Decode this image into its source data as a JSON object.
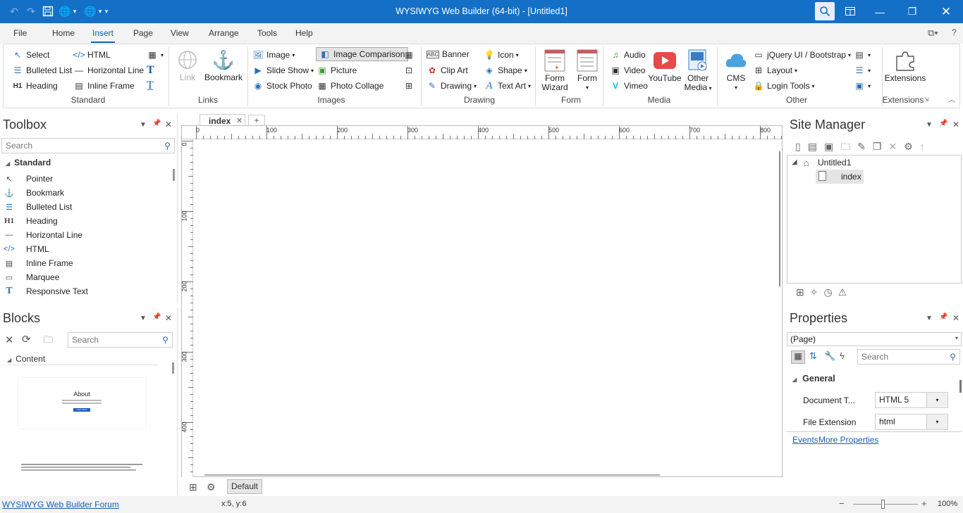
{
  "titlebar": {
    "title": "WYSIWYG Web Builder (64-bit) - [Untitled1]"
  },
  "menu": {
    "items": [
      "File",
      "Home",
      "Insert",
      "Page",
      "View",
      "Arrange",
      "Tools",
      "Help"
    ],
    "active": "Insert"
  },
  "ribbon": {
    "standard": {
      "select": "Select",
      "html": "HTML",
      "bulleted": "Bulleted List",
      "hline": "Horizontal Line",
      "heading": "Heading",
      "iframe": "Inline Frame",
      "group": "Standard"
    },
    "links": {
      "link": "Link",
      "bookmark": "Bookmark",
      "group": "Links"
    },
    "images": {
      "image": "Image",
      "compare": "Image Comparison",
      "slideshow": "Slide Show",
      "picture": "Picture",
      "stock": "Stock Photo",
      "collage": "Photo Collage",
      "group": "Images"
    },
    "drawing": {
      "banner": "Banner",
      "icon": "Icon",
      "clipart": "Clip Art",
      "shape": "Shape",
      "drawing": "Drawing",
      "textart": "Text Art",
      "group": "Drawing"
    },
    "form": {
      "wizard1": "Form",
      "wizard2": "Wizard",
      "form": "Form",
      "group": "Form"
    },
    "media": {
      "audio": "Audio",
      "video": "Video",
      "vimeo": "Vimeo",
      "youtube": "YouTube",
      "other1": "Other",
      "other2": "Media",
      "group": "Media"
    },
    "other": {
      "cms": "CMS",
      "jquery": "jQuery UI / Bootstrap",
      "layout": "Layout",
      "login": "Login Tools",
      "group": "Other"
    },
    "extensions": {
      "label": "Extensions",
      "group": "Extensions"
    }
  },
  "toolbox": {
    "title": "Toolbox",
    "search_placeholder": "Search",
    "category": "Standard",
    "items": [
      "Pointer",
      "Bookmark",
      "Bulleted List",
      "Heading",
      "Horizontal Line",
      "HTML",
      "Inline Frame",
      "Marquee",
      "Responsive Text"
    ]
  },
  "blocks": {
    "title": "Blocks",
    "search_placeholder": "Search",
    "category": "Content",
    "thumb_title": "About",
    "thumb_button": "Learn More"
  },
  "document": {
    "tab": "index",
    "add_tab": "+",
    "ruler_h": [
      "0",
      "100",
      "200",
      "300",
      "400",
      "500",
      "600",
      "700",
      "800"
    ],
    "ruler_v": [
      "0",
      "100",
      "200",
      "300",
      "400"
    ],
    "master_button": "Default"
  },
  "site_manager": {
    "title": "Site Manager",
    "root": "Untitled1",
    "page": "index"
  },
  "properties": {
    "title": "Properties",
    "selector": "(Page)",
    "search_placeholder": "Search",
    "section": "General",
    "rows": [
      {
        "label": "Document T...",
        "value": "HTML 5"
      },
      {
        "label": "File Extension",
        "value": "html"
      }
    ],
    "link_events": "Events",
    "link_more": "More Properties"
  },
  "status": {
    "forum": "WYSIWYG Web Builder Forum",
    "coords": "x:5, y:6",
    "zoom": "100%"
  },
  "colors": {
    "accent": "#1470c7",
    "link": "#1a5fb4"
  }
}
